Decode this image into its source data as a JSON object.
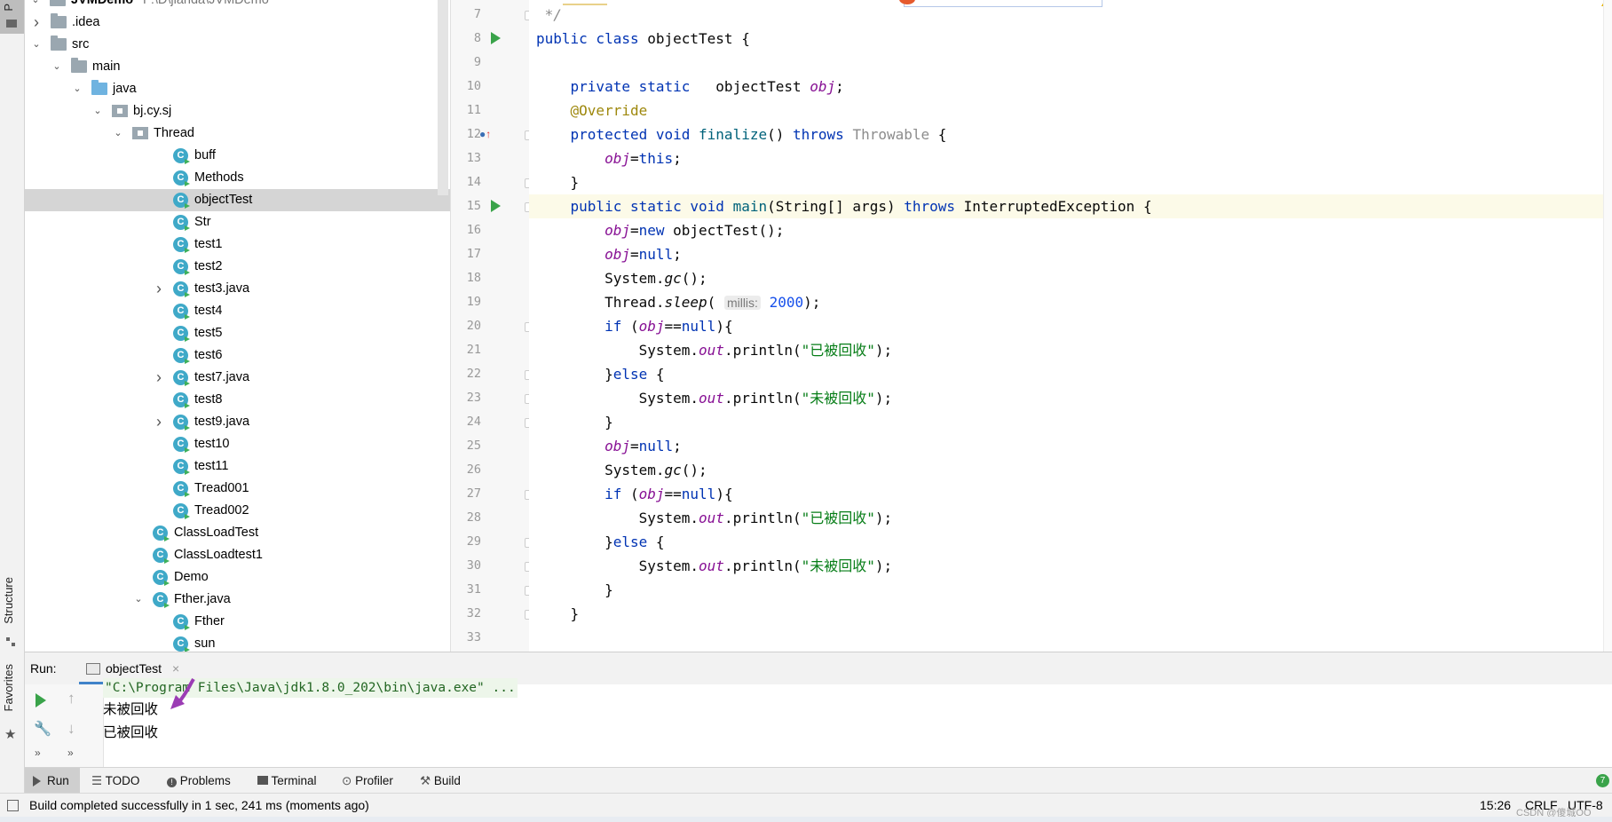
{
  "left_strip": {
    "project_tab": "P",
    "structure_tab": "Structure",
    "favorites_tab": "Favorites"
  },
  "project": {
    "root": {
      "name": "JVMDemo",
      "path": "F:\\D\\jianda\\JVMDemo"
    },
    "items": [
      {
        "label": ".idea",
        "type": "folder",
        "depth": 1,
        "expander": ">"
      },
      {
        "label": "src",
        "type": "folder",
        "depth": 1,
        "expander": "v"
      },
      {
        "label": "main",
        "type": "folder",
        "depth": 2,
        "expander": "v"
      },
      {
        "label": "java",
        "type": "folder-blue",
        "depth": 3,
        "expander": "v"
      },
      {
        "label": "bj.cy.sj",
        "type": "package",
        "depth": 4,
        "expander": "v"
      },
      {
        "label": "Thread",
        "type": "package",
        "depth": 5,
        "expander": "v"
      },
      {
        "label": "buff",
        "type": "class",
        "depth": 7,
        "expander": ""
      },
      {
        "label": "Methods",
        "type": "class",
        "depth": 7,
        "expander": ""
      },
      {
        "label": "objectTest",
        "type": "class",
        "depth": 7,
        "expander": "",
        "selected": true
      },
      {
        "label": "Str",
        "type": "class",
        "depth": 7,
        "expander": ""
      },
      {
        "label": "test1",
        "type": "class",
        "depth": 7,
        "expander": ""
      },
      {
        "label": "test2",
        "type": "class",
        "depth": 7,
        "expander": ""
      },
      {
        "label": "test3.java",
        "type": "class",
        "depth": 7,
        "expander": ">"
      },
      {
        "label": "test4",
        "type": "class",
        "depth": 7,
        "expander": ""
      },
      {
        "label": "test5",
        "type": "class",
        "depth": 7,
        "expander": ""
      },
      {
        "label": "test6",
        "type": "class",
        "depth": 7,
        "expander": ""
      },
      {
        "label": "test7.java",
        "type": "class",
        "depth": 7,
        "expander": ">"
      },
      {
        "label": "test8",
        "type": "class",
        "depth": 7,
        "expander": ""
      },
      {
        "label": "test9.java",
        "type": "class",
        "depth": 7,
        "expander": ">"
      },
      {
        "label": "test10",
        "type": "class",
        "depth": 7,
        "expander": ""
      },
      {
        "label": "test11",
        "type": "class",
        "depth": 7,
        "expander": ""
      },
      {
        "label": "Tread001",
        "type": "class",
        "depth": 7,
        "expander": ""
      },
      {
        "label": "Tread002",
        "type": "class",
        "depth": 7,
        "expander": ""
      },
      {
        "label": "ClassLoadTest",
        "type": "class",
        "depth": 6,
        "expander": ""
      },
      {
        "label": "ClassLoadtest1",
        "type": "class",
        "depth": 6,
        "expander": ""
      },
      {
        "label": "Demo",
        "type": "class",
        "depth": 6,
        "expander": ""
      },
      {
        "label": "Fther.java",
        "type": "class",
        "depth": 6,
        "expander": "v"
      },
      {
        "label": "Fther",
        "type": "class",
        "depth": 7,
        "expander": ""
      },
      {
        "label": "sun",
        "type": "class",
        "depth": 7,
        "expander": ""
      }
    ]
  },
  "editor": {
    "line_numbers": [
      "7",
      "8",
      "9",
      "10",
      "11",
      "12",
      "13",
      "14",
      "15",
      "16",
      "17",
      "18",
      "19",
      "20",
      "21",
      "22",
      "23",
      "24",
      "25",
      "26",
      "27",
      "28",
      "29",
      "30",
      "31",
      "32",
      "33"
    ],
    "code": {
      "l7": " */",
      "l8_kw": "public class ",
      "l8_rest": "objectTest {",
      "l10_kw": "    private static   ",
      "l10_type": "objectTest ",
      "l10_fld": "obj",
      "l10_end": ";",
      "l11_ann": "    @Override",
      "l12_kw": "    protected void ",
      "l12_m": "finalize",
      "l12_a": "() ",
      "l12_kw2": "throws ",
      "l12_gray": "Throwable",
      "l12_end": " {",
      "l13_fld": "        obj",
      "l13_eq": "=",
      "l13_kw": "this",
      "l13_end": ";",
      "l14": "    }",
      "l15_kw": "    public static void ",
      "l15_m": "main",
      "l15_a": "(String[] args) ",
      "l15_kw2": "throws ",
      "l15_end": "InterruptedException {",
      "l16_fld": "        obj",
      "l16_eq": "=",
      "l16_kw": "new ",
      "l16_end": "objectTest();",
      "l17_fld": "        obj",
      "l17_eq": "=",
      "l17_kw": "null",
      "l17_end": ";",
      "l18_a": "        System.",
      "l18_m": "gc",
      "l18_end": "();",
      "l19_a": "        Thread.",
      "l19_m": "sleep",
      "l19_p": "( ",
      "l19_hint": "millis:",
      "l19_num": " 2000",
      "l19_end": ");",
      "l20_kw": "        if ",
      "l20_p": "(",
      "l20_fld": "obj",
      "l20_eq": "==",
      "l20_kw2": "null",
      "l20_end": "){",
      "l21_a": "            System.",
      "l21_out": "out",
      "l21_b": ".println(",
      "l21_str": "\"已被回收\"",
      "l21_end": ");",
      "l22_a": "        }",
      "l22_kw": "else",
      "l22_end": " {",
      "l23_a": "            System.",
      "l23_out": "out",
      "l23_b": ".println(",
      "l23_str": "\"未被回收\"",
      "l23_end": ");",
      "l24": "        }",
      "l25_fld": "        obj",
      "l25_eq": "=",
      "l25_kw": "null",
      "l25_end": ";",
      "l26_a": "        System.",
      "l26_m": "gc",
      "l26_end": "();",
      "l27_kw": "        if ",
      "l27_p": "(",
      "l27_fld": "obj",
      "l27_eq": "==",
      "l27_kw2": "null",
      "l27_end": "){",
      "l28_a": "            System.",
      "l28_out": "out",
      "l28_b": ".println(",
      "l28_str": "\"已被回收\"",
      "l28_end": ");",
      "l29_a": "        }",
      "l29_kw": "else",
      "l29_end": " {",
      "l30_a": "            System.",
      "l30_out": "out",
      "l30_b": ".println(",
      "l30_str": "\"未被回收\"",
      "l30_end": ");",
      "l31": "        }",
      "l32": "    }"
    }
  },
  "run": {
    "label": "Run:",
    "tab": "objectTest",
    "console": {
      "command": "\"C:\\Program Files\\Java\\jdk1.8.0_202\\bin\\java.exe\" ...",
      "lines": [
        "未被回收",
        "已被回收"
      ]
    }
  },
  "bottom_tools": [
    "Run",
    "TODO",
    "Problems",
    "Terminal",
    "Profiler",
    "Build"
  ],
  "status": {
    "message": "Build completed successfully in 1 sec, 241 ms (moments ago)",
    "position": "15:26",
    "line_sep": "CRLF",
    "encoding": "UTF-8",
    "event_count": "7",
    "watermark": "CSDN @傻城OO"
  },
  "colors": {
    "accent": "#4083c9",
    "run_green": "#3aa34a",
    "class_icon": "#3fa9c8",
    "arrow": "#9b3cb4"
  }
}
